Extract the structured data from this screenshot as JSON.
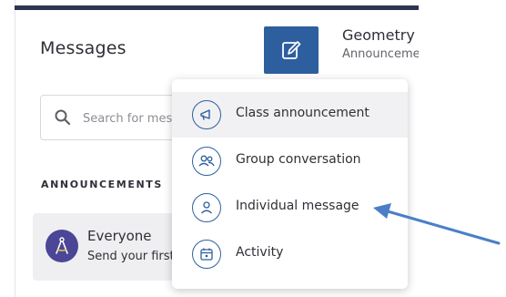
{
  "sidebar": {
    "title": "Messages",
    "search": {
      "placeholder": "Search for mes",
      "value": ""
    },
    "section_label": "ANNOUNCEMENTS",
    "card": {
      "name": "Everyone",
      "preview": "Send your first"
    }
  },
  "header": {
    "class_title": "Geometry",
    "class_subtitle": "Announceme"
  },
  "menu": {
    "items": [
      {
        "label": "Class announcement",
        "icon": "megaphone-icon"
      },
      {
        "label": "Group conversation",
        "icon": "group-icon"
      },
      {
        "label": "Individual message",
        "icon": "person-icon"
      },
      {
        "label": "Activity",
        "icon": "calendar-icon"
      }
    ]
  },
  "colors": {
    "accent": "#2d5f9f",
    "top_bar": "#2d3552",
    "avatar": "#4b4796",
    "arrow": "#4a7fc7"
  }
}
